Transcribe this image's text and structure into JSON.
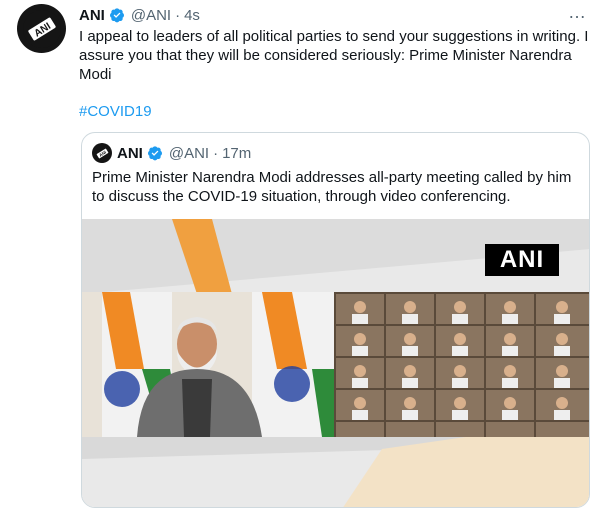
{
  "tweet": {
    "author_name": "ANI",
    "handle": "@ANI",
    "separator": "·",
    "time": "4s",
    "text": "I appeal to leaders of all political parties to send your suggestions in writing. I assure you that they will be considered seriously: Prime Minister Narendra Modi",
    "hashtag": "#COVID19",
    "more_icon": "…",
    "avatar_logo": "ani-logo"
  },
  "quoted": {
    "author_name": "ANI",
    "handle": "@ANI",
    "separator": "·",
    "time": "17m",
    "text": "Prime Minister Narendra Modi addresses all-party meeting called by him to discuss the COVID-19 situation, through video conferencing.",
    "media_watermark": "ANI"
  },
  "colors": {
    "link": "#1d9bf0",
    "secondary_text": "#536471",
    "verified": "#1d9bf0",
    "border": "#cfd9de"
  }
}
